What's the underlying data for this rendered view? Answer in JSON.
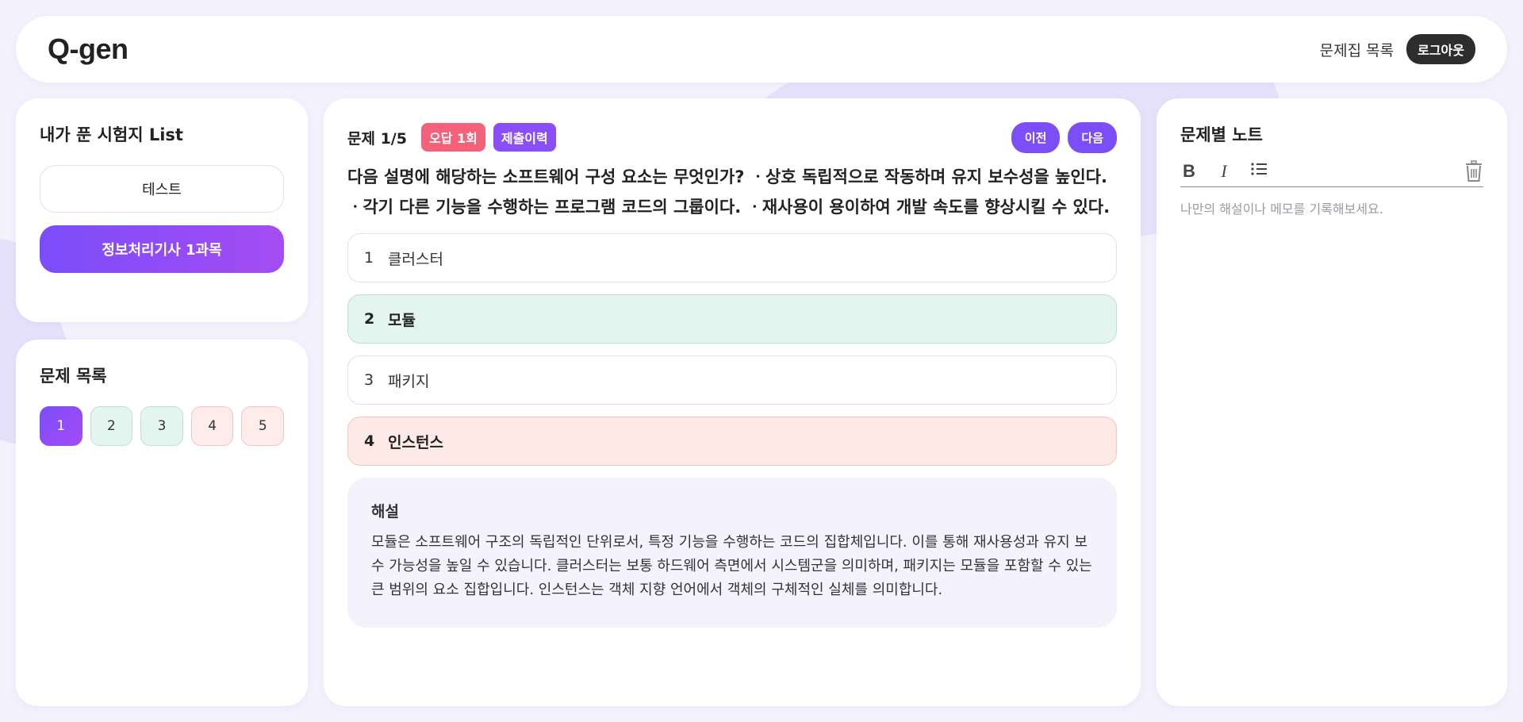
{
  "header": {
    "logo": "Q-gen",
    "nav_link": "문제집 목록",
    "logout": "로그아웃"
  },
  "exam_list": {
    "title": "내가 푼 시험지 List",
    "items": [
      {
        "label": "테스트",
        "active": false
      },
      {
        "label": "정보처리기사 1과목",
        "active": true
      }
    ]
  },
  "question_list": {
    "title": "문제 목록",
    "items": [
      {
        "label": "1",
        "state": "current"
      },
      {
        "label": "2",
        "state": "correct"
      },
      {
        "label": "3",
        "state": "correct"
      },
      {
        "label": "4",
        "state": "wrong"
      },
      {
        "label": "5",
        "state": "wrong"
      }
    ]
  },
  "question": {
    "counter": "문제 1/5",
    "wrong_badge": "오답 1회",
    "history_badge": "제출이력",
    "prev": "이전",
    "next": "다음",
    "text": "다음 설명에 해당하는 소프트웨어 구성 요소는 무엇인가? ㆍ상호 독립적으로 작동하며 유지 보수성을 높인다. ㆍ각기 다른 기능을 수행하는 프로그램 코드의 그룹이다. ㆍ재사용이 용이하여 개발 속도를 향상시킬 수 있다.",
    "choices": [
      {
        "num": "1",
        "label": "클러스터",
        "state": "none"
      },
      {
        "num": "2",
        "label": "모듈",
        "state": "correct"
      },
      {
        "num": "3",
        "label": "패키지",
        "state": "none"
      },
      {
        "num": "4",
        "label": "인스턴스",
        "state": "wrong"
      }
    ],
    "explanation_title": "해설",
    "explanation": "모듈은 소프트웨어 구조의 독립적인 단위로서, 특정 기능을 수행하는 코드의 집합체입니다. 이를 통해 재사용성과 유지 보수 가능성을 높일 수 있습니다. 클러스터는 보통 하드웨어 측면에서 시스템군을 의미하며, 패키지는 모듈을 포함할 수 있는 큰 범위의 요소 집합입니다. 인스턴스는 객체 지향 언어에서 객체의 구체적인 실체를 의미합니다."
  },
  "note": {
    "title": "문제별 노트",
    "tools": {
      "bold": "B",
      "italic": "I"
    },
    "placeholder": "나만의 해설이나 메모를 기록해보세요."
  },
  "colors": {
    "accent": "#7c4ef7",
    "correct_bg": "#e4f5ef",
    "wrong_bg": "#fdeae7",
    "wrong_badge": "#f2627b"
  }
}
